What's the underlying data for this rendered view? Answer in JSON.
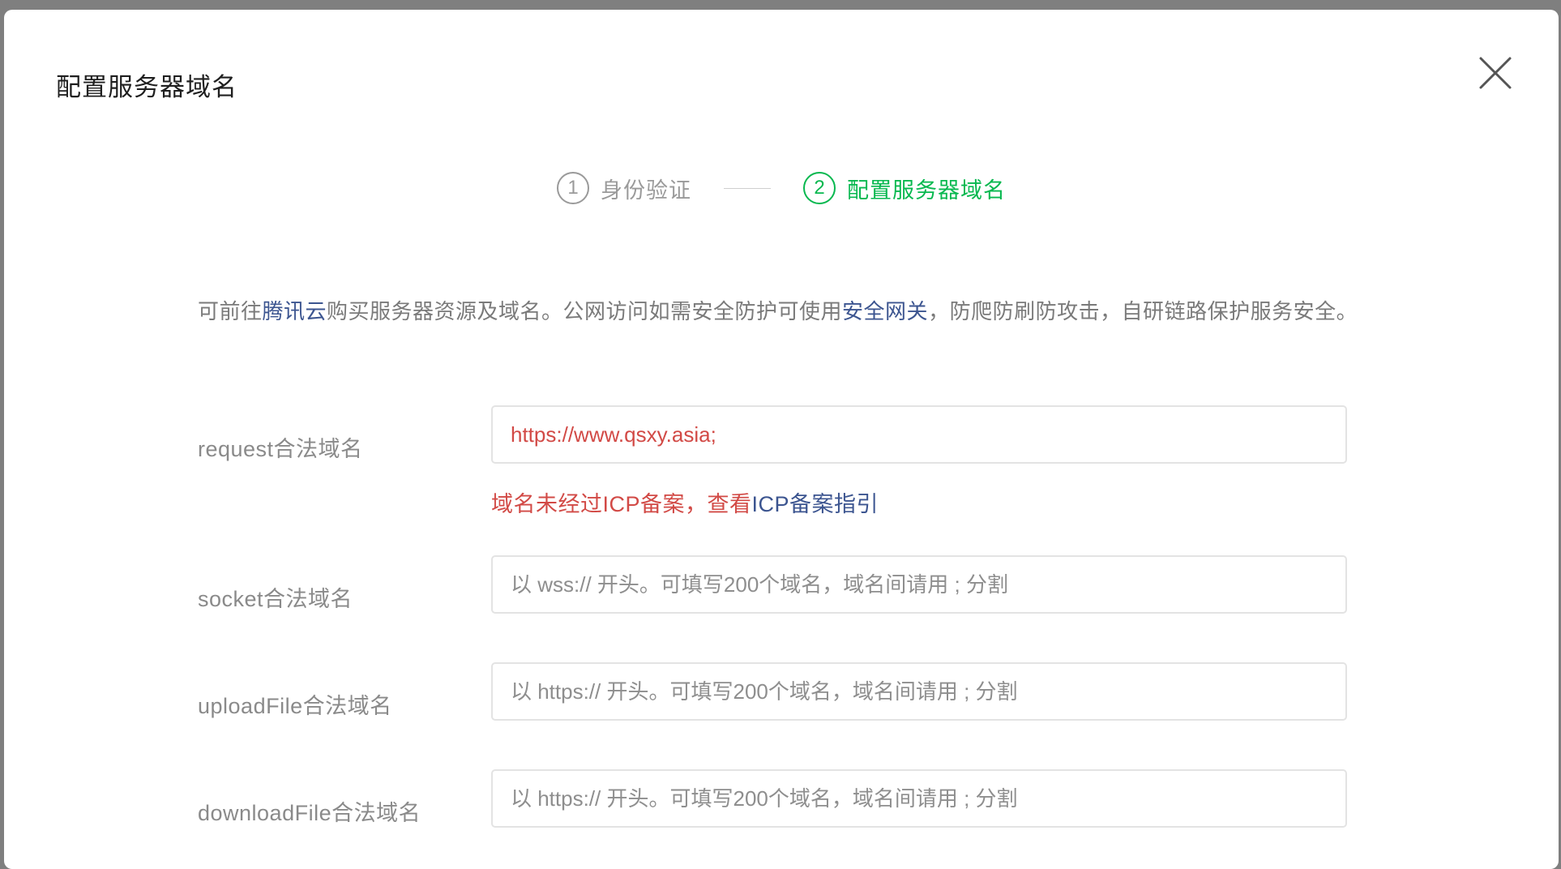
{
  "dialog": {
    "title": "配置服务器域名"
  },
  "steps": [
    {
      "number": "1",
      "label": "身份验证",
      "state": "done"
    },
    {
      "number": "2",
      "label": "配置服务器域名",
      "state": "active"
    }
  ],
  "intro": {
    "part1": "可前往",
    "link1": "腾讯云",
    "part2": "购买服务器资源及域名。公网访问如需安全防护可使用",
    "link2": "安全网关",
    "part3": "，防爬防刷防攻击，自研链路保护服务安全。"
  },
  "fields": {
    "request": {
      "label": "request合法域名",
      "value": "https://www.qsxy.asia;",
      "error_text": "域名未经过ICP备案，查看",
      "error_link": "ICP备案指引"
    },
    "socket": {
      "label": "socket合法域名",
      "placeholder": "以 wss:// 开头。可填写200个域名，域名间请用 ; 分割"
    },
    "uploadFile": {
      "label": "uploadFile合法域名",
      "placeholder": "以 https:// 开头。可填写200个域名，域名间请用 ; 分割"
    },
    "downloadFile": {
      "label": "downloadFile合法域名",
      "placeholder": "以 https:// 开头。可填写200个域名，域名间请用 ; 分割"
    }
  },
  "colors": {
    "active_green": "#07b84f",
    "error_red": "#d24a46",
    "link_blue": "#3c5590"
  }
}
